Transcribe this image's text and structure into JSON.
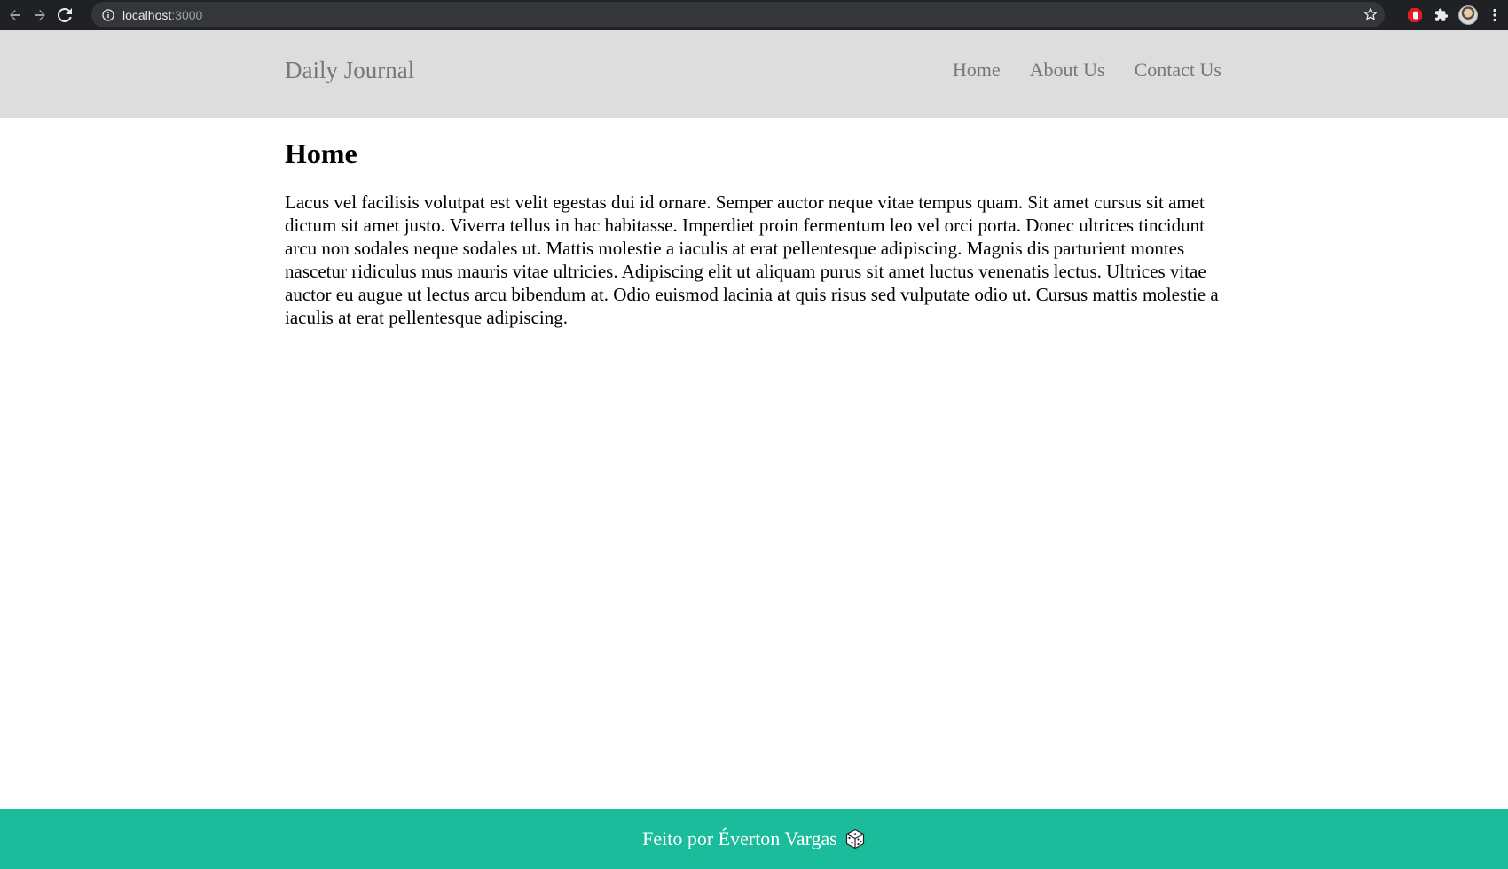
{
  "browser": {
    "url_host": "localhost",
    "url_port": ":3000",
    "icons": [
      "back-arrow-icon",
      "forward-arrow-icon",
      "reload-icon",
      "info-icon",
      "star-icon",
      "adblock-icon",
      "puzzle-extension-icon",
      "profile-avatar",
      "kebab-menu-icon"
    ]
  },
  "header": {
    "brand": "Daily Journal",
    "nav": [
      {
        "label": "Home"
      },
      {
        "label": "About Us"
      },
      {
        "label": "Contact Us"
      }
    ],
    "background": "#dddddd",
    "text_color": "#777777"
  },
  "main": {
    "title": "Home",
    "body": "Lacus vel facilisis volutpat est velit egestas dui id ornare. Semper auctor neque vitae tempus quam. Sit amet cursus sit amet dictum sit amet justo. Viverra tellus in hac habitasse. Imperdiet proin fermentum leo vel orci porta. Donec ultrices tincidunt arcu non sodales neque sodales ut. Mattis molestie a iaculis at erat pellentesque adipiscing. Magnis dis parturient montes nascetur ridiculus mus mauris vitae ultricies. Adipiscing elit ut aliquam purus sit amet luctus venenatis lectus. Ultrices vitae auctor eu augue ut lectus arcu bibendum at. Odio euismod lacinia at quis risus sed vulputate odio ut. Cursus mattis molestie a iaculis at erat pellentesque adipiscing."
  },
  "footer": {
    "text": "Feito por Éverton Vargas",
    "icon": "dice-icon",
    "background": "#1abc9c"
  }
}
